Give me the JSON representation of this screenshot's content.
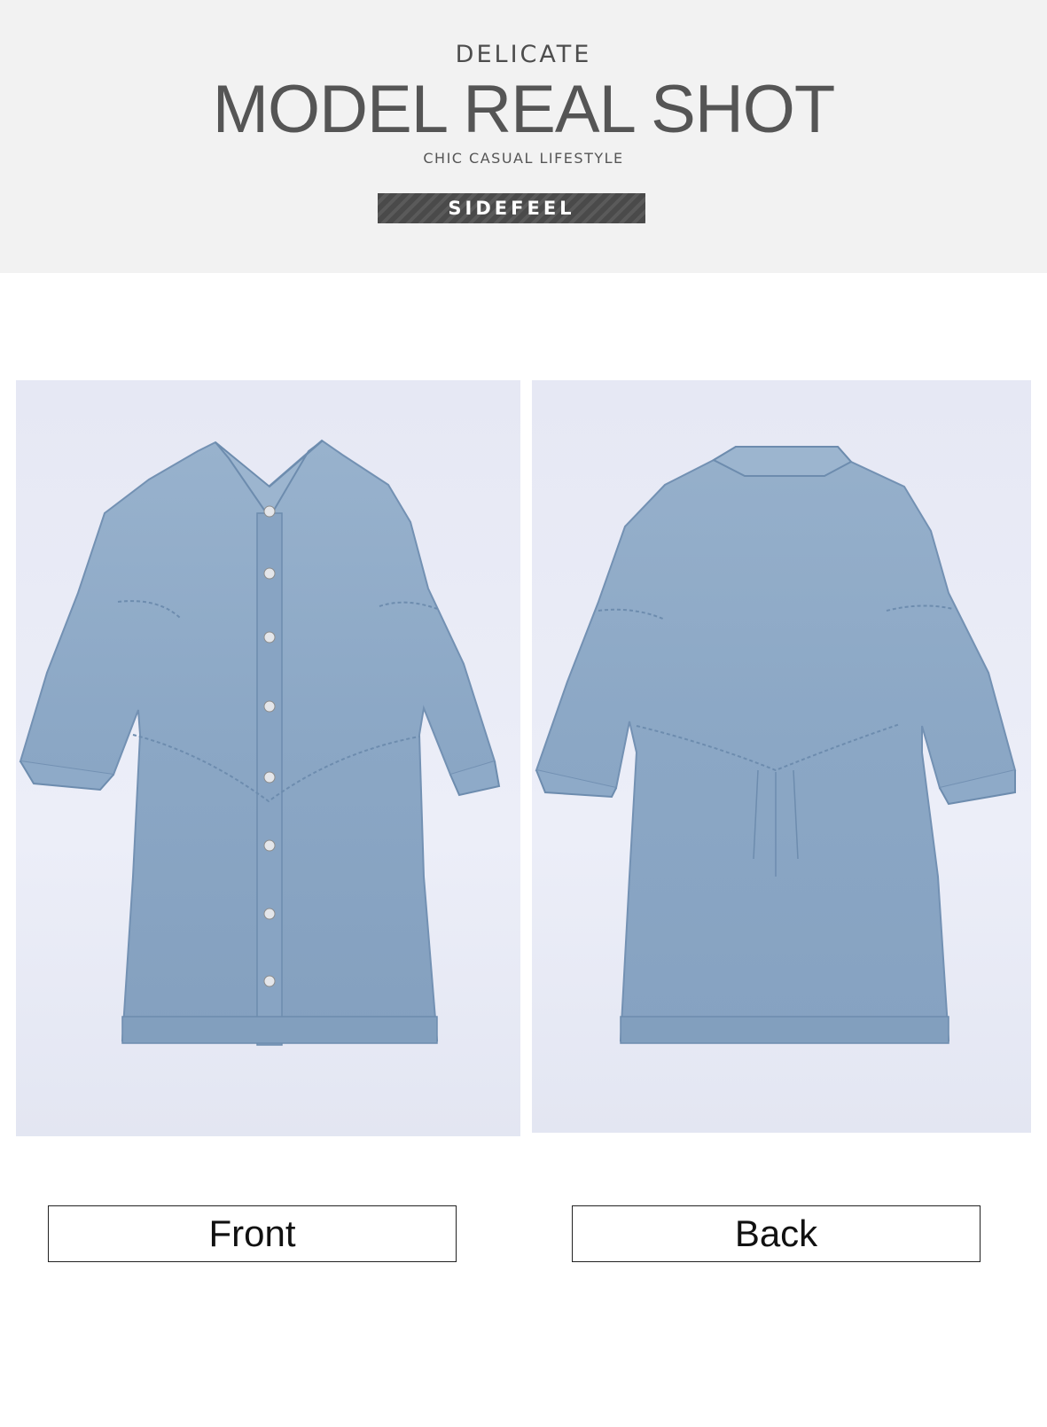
{
  "header": {
    "kicker": "DELICATE",
    "headline": "MODEL REAL SHOT",
    "subhead": "CHIC CASUAL LIFESTYLE",
    "brand": "SIDEFEEL"
  },
  "photos": {
    "front_icon": "denim-shirt-dress-front",
    "back_icon": "denim-shirt-dress-back"
  },
  "labels": {
    "front": "Front",
    "back": "Back"
  },
  "colors": {
    "header_bg": "#f2f2f2",
    "photo_bg": "#e8eaf5",
    "denim": "#8aa6c4",
    "denim_dark": "#6f8fb2",
    "brand_bar": "#4e4e4e"
  }
}
